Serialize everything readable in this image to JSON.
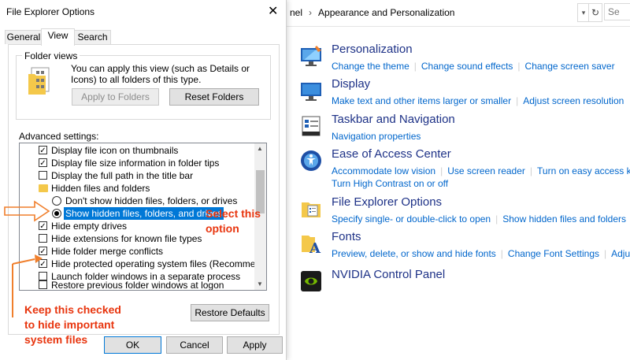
{
  "dialog": {
    "title": "File Explorer Options",
    "tabs": [
      "General",
      "View",
      "Search"
    ],
    "folder_views": {
      "label": "Folder views",
      "description": "You can apply this view (such as Details or Icons) to all folders of this type.",
      "apply_button": "Apply to Folders",
      "reset_button": "Reset Folders"
    },
    "advanced_label": "Advanced settings:",
    "tree": [
      {
        "type": "checkbox",
        "checked": true,
        "label": "Display file icon on thumbnails"
      },
      {
        "type": "checkbox",
        "checked": true,
        "label": "Display file size information in folder tips"
      },
      {
        "type": "checkbox",
        "checked": false,
        "label": "Display the full path in the title bar"
      },
      {
        "type": "folder",
        "label": "Hidden files and folders"
      },
      {
        "type": "radio",
        "checked": false,
        "label": "Don't show hidden files, folders, or drives"
      },
      {
        "type": "radio",
        "checked": true,
        "label": "Show hidden files, folders, and drives"
      },
      {
        "type": "checkbox",
        "checked": true,
        "label": "Hide empty drives"
      },
      {
        "type": "checkbox",
        "checked": false,
        "label": "Hide extensions for known file types"
      },
      {
        "type": "checkbox",
        "checked": true,
        "label": "Hide folder merge conflicts"
      },
      {
        "type": "checkbox",
        "checked": true,
        "label": "Hide protected operating system files (Recommended)"
      },
      {
        "type": "checkbox",
        "checked": false,
        "label": "Launch folder windows in a separate process"
      },
      {
        "type": "checkbox",
        "checked": false,
        "label": "Restore previous folder windows at logon"
      }
    ],
    "restore_defaults": "Restore Defaults",
    "ok": "OK",
    "cancel": "Cancel",
    "apply": "Apply"
  },
  "annotations": {
    "select_line1": "Select this",
    "select_line2": "option",
    "keep_line1": "Keep this checked",
    "keep_line2": "to hide important",
    "keep_line3": "system files",
    "color": "#e8350e"
  },
  "control_panel": {
    "breadcrumb_prefix": "nel",
    "breadcrumb": "Appearance and Personalization",
    "search_placeholder": "Se",
    "categories": [
      {
        "icon": "personalization-icon",
        "title": "Personalization",
        "links": [
          "Change the theme",
          "Change sound effects",
          "Change screen saver"
        ]
      },
      {
        "icon": "display-icon",
        "title": "Display",
        "links": [
          "Make text and other items larger or smaller",
          "Adjust screen resolution"
        ]
      },
      {
        "icon": "taskbar-icon",
        "title": "Taskbar and Navigation",
        "links": [
          "Navigation properties"
        ]
      },
      {
        "icon": "ease-of-access-icon",
        "title": "Ease of Access Center",
        "links": [
          "Accommodate low vision",
          "Use screen reader",
          "Turn on easy access ke",
          "Turn High Contrast on or off"
        ]
      },
      {
        "icon": "file-explorer-options-icon",
        "title": "File Explorer Options",
        "links": [
          "Specify single- or double-click to open",
          "Show hidden files and folders"
        ]
      },
      {
        "icon": "fonts-icon",
        "title": "Fonts",
        "links": [
          "Preview, delete, or show and hide fonts",
          "Change Font Settings",
          "Adjus"
        ]
      },
      {
        "icon": "nvidia-icon",
        "title": "NVIDIA Control Panel",
        "links": []
      }
    ]
  }
}
